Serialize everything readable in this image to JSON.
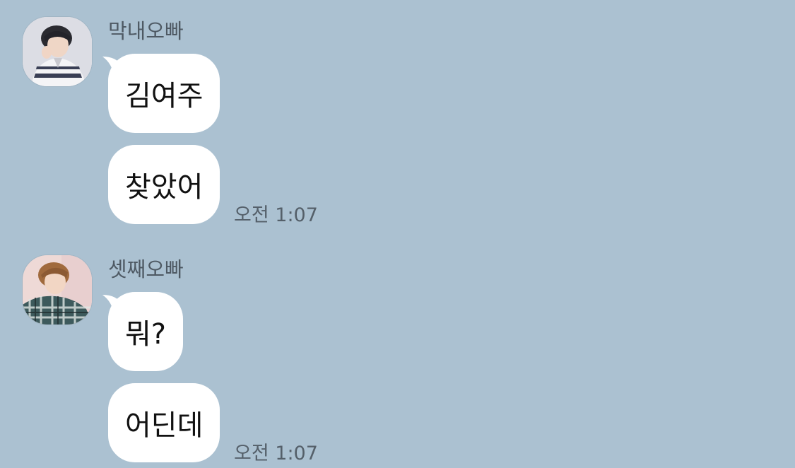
{
  "colors": {
    "background": "#abc1d1",
    "bubble": "#ffffff",
    "sender_text": "#4e5963",
    "time_text": "#55606a"
  },
  "messages": [
    {
      "sender": "막내오빠",
      "avatar_icon": "profile-photo-boy-white-sweater",
      "bubbles": [
        "김여주",
        "찾았어"
      ],
      "time": "오전 1:07"
    },
    {
      "sender": "셋째오빠",
      "avatar_icon": "profile-photo-boy-plaid-shirt",
      "bubbles": [
        "뭐?",
        "어딘데"
      ],
      "time": "오전 1:07"
    }
  ]
}
